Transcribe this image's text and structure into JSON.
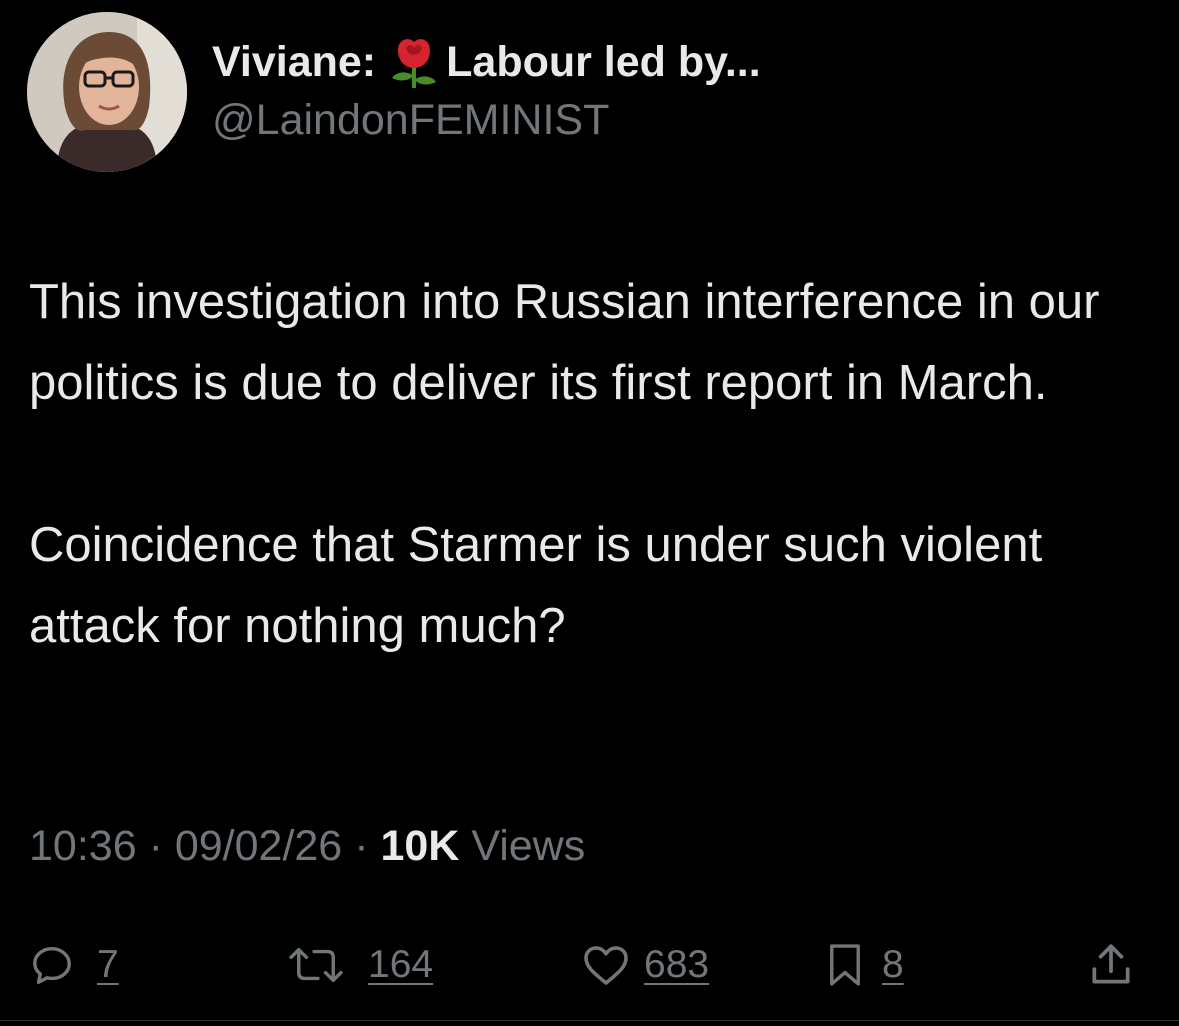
{
  "author": {
    "display_name_prefix": "Viviane:",
    "display_name_suffix": "Labour led by...",
    "handle": "@LaindonFEMINIST",
    "name_emoji": "rose"
  },
  "tweet": {
    "paragraphs": [
      "This investigation into Russian interference in our politics is due to deliver its first report in March.",
      "Coincidence that Starmer is under such violent attack for nothing much?"
    ],
    "time": "10:36",
    "separator": "·",
    "date": "09/02/26",
    "views_count": "10K",
    "views_label": "Views"
  },
  "actions": {
    "replies": "7",
    "reposts": "164",
    "likes": "683",
    "bookmarks": "8"
  },
  "icons": {
    "reply": "reply-bubble-icon",
    "repost": "repost-arrows-icon",
    "like": "heart-icon",
    "bookmark": "bookmark-icon",
    "share": "share-upload-icon"
  },
  "colors": {
    "background": "#000000",
    "primary_text": "#e7e9ea",
    "secondary_text": "#71767b",
    "rose_red": "#d5232f",
    "rose_green": "#4a8a2a"
  }
}
